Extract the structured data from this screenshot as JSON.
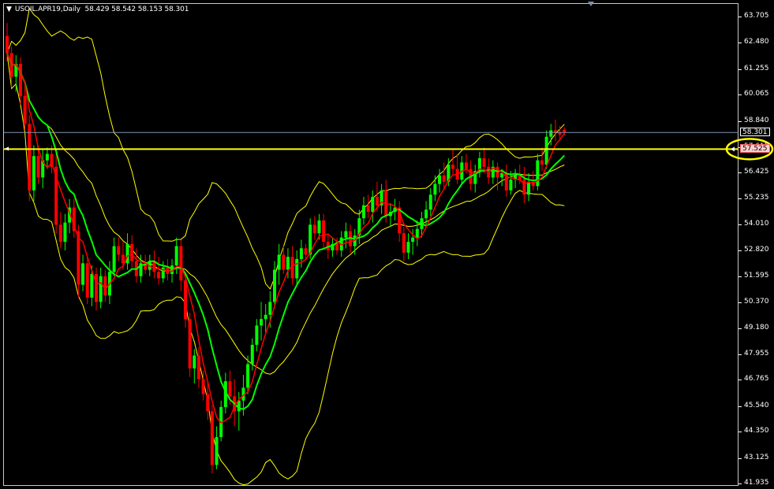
{
  "header": {
    "symbol_tf": "USOIL.APR19,Daily",
    "ohlc": "58.429 58.542 58.153 58.301"
  },
  "price_axis": {
    "labels": [
      "63.705",
      "62.480",
      "61.255",
      "60.065",
      "58.840",
      "57.615",
      "56.425",
      "55.235",
      "54.010",
      "52.820",
      "51.595",
      "50.370",
      "49.180",
      "47.955",
      "46.765",
      "45.540",
      "44.350",
      "43.125",
      "41.935"
    ],
    "range": [
      41.935,
      63.705
    ]
  },
  "markers": {
    "bid_line": {
      "price": 58.301,
      "label": "58.301",
      "color": "#7f96b4"
    },
    "horizontal_line": {
      "price": 57.525,
      "label": "57.525",
      "color": "#ffff00"
    }
  },
  "colors": {
    "bull": "#00ff00",
    "bear": "#ff0000",
    "ma_fast": "#ff0000",
    "ma_slow": "#00ff00",
    "bands": "#ffff00",
    "background": "#000000",
    "highlight_ellipse": "#ffff00"
  },
  "icons": {
    "dropdown": "triangle-down-icon",
    "shift_marker": "triangle-down-icon"
  },
  "chart_data": {
    "type": "candlestick",
    "ylim": [
      41.935,
      63.705
    ],
    "candles": [
      [
        62.8,
        63.4,
        61.6,
        62.0
      ],
      [
        62.0,
        62.3,
        60.4,
        60.9
      ],
      [
        60.9,
        61.9,
        60.2,
        61.5
      ],
      [
        61.5,
        61.8,
        59.6,
        60.0
      ],
      [
        60.0,
        60.6,
        58.4,
        58.7
      ],
      [
        58.7,
        59.1,
        55.1,
        55.6
      ],
      [
        55.6,
        57.7,
        55.1,
        57.2
      ],
      [
        57.2,
        57.7,
        55.9,
        56.2
      ],
      [
        56.2,
        57.5,
        55.7,
        57.0
      ],
      [
        57.0,
        57.6,
        56.6,
        57.3
      ],
      [
        57.3,
        57.7,
        56.4,
        56.7
      ],
      [
        56.7,
        57.4,
        53.6,
        54.0
      ],
      [
        54.0,
        54.6,
        52.9,
        53.2
      ],
      [
        53.2,
        54.5,
        52.8,
        54.1
      ],
      [
        54.1,
        55.2,
        53.6,
        54.8
      ],
      [
        54.8,
        55.2,
        53.4,
        53.7
      ],
      [
        53.7,
        54.0,
        50.6,
        51.2
      ],
      [
        51.2,
        52.6,
        50.9,
        52.2
      ],
      [
        52.2,
        52.5,
        50.3,
        50.6
      ],
      [
        50.6,
        52.1,
        50.2,
        51.7
      ],
      [
        51.7,
        52.0,
        50.0,
        50.4
      ],
      [
        50.4,
        52.0,
        50.1,
        51.6
      ],
      [
        51.6,
        51.9,
        50.4,
        50.7
      ],
      [
        50.7,
        52.3,
        50.3,
        51.8
      ],
      [
        51.8,
        53.4,
        51.6,
        53.0
      ],
      [
        53.0,
        53.4,
        52.3,
        52.6
      ],
      [
        52.6,
        53.2,
        51.9,
        52.2
      ],
      [
        52.2,
        53.6,
        51.9,
        53.1
      ],
      [
        53.1,
        53.5,
        52.0,
        52.3
      ],
      [
        52.3,
        52.9,
        51.3,
        51.6
      ],
      [
        51.6,
        52.6,
        51.3,
        52.2
      ],
      [
        52.2,
        52.6,
        51.7,
        51.9
      ],
      [
        51.9,
        52.6,
        51.6,
        52.3
      ],
      [
        52.3,
        52.8,
        51.5,
        51.8
      ],
      [
        51.8,
        52.5,
        51.2,
        51.5
      ],
      [
        51.5,
        52.3,
        51.3,
        52.0
      ],
      [
        52.0,
        52.4,
        51.4,
        51.7
      ],
      [
        51.7,
        52.4,
        51.3,
        52.1
      ],
      [
        52.1,
        53.4,
        51.7,
        53.0
      ],
      [
        53.0,
        53.3,
        50.9,
        51.4
      ],
      [
        51.4,
        51.8,
        49.2,
        49.6
      ],
      [
        49.6,
        49.9,
        46.9,
        47.3
      ],
      [
        47.3,
        48.2,
        46.6,
        47.9
      ],
      [
        47.9,
        48.3,
        46.4,
        46.8
      ],
      [
        46.8,
        47.2,
        45.8,
        46.1
      ],
      [
        46.1,
        46.7,
        44.9,
        45.3
      ],
      [
        45.3,
        45.6,
        42.4,
        42.8
      ],
      [
        42.8,
        44.6,
        42.6,
        44.1
      ],
      [
        44.1,
        45.8,
        43.9,
        45.5
      ],
      [
        45.5,
        47.1,
        45.2,
        46.7
      ],
      [
        46.7,
        47.2,
        45.6,
        46.0
      ],
      [
        46.0,
        46.8,
        44.6,
        45.3
      ],
      [
        45.3,
        46.2,
        44.4,
        45.8
      ],
      [
        45.8,
        47.0,
        45.1,
        46.4
      ],
      [
        46.4,
        47.9,
        46.1,
        47.5
      ],
      [
        47.5,
        48.7,
        47.2,
        48.4
      ],
      [
        48.4,
        49.6,
        48.1,
        49.3
      ],
      [
        49.3,
        50.4,
        48.6,
        49.6
      ],
      [
        49.6,
        50.3,
        49.0,
        49.8
      ],
      [
        49.8,
        50.9,
        49.2,
        50.4
      ],
      [
        50.4,
        52.3,
        50.1,
        51.9
      ],
      [
        51.9,
        53.1,
        51.2,
        52.6
      ],
      [
        52.6,
        53.0,
        51.7,
        51.9
      ],
      [
        51.9,
        52.9,
        51.5,
        52.5
      ],
      [
        52.5,
        53.0,
        51.2,
        51.5
      ],
      [
        51.5,
        52.8,
        51.2,
        52.4
      ],
      [
        52.4,
        53.3,
        52.0,
        52.9
      ],
      [
        52.9,
        53.1,
        52.4,
        52.6
      ],
      [
        52.6,
        54.3,
        52.4,
        54.0
      ],
      [
        54.0,
        54.4,
        53.3,
        53.6
      ],
      [
        53.6,
        54.5,
        53.3,
        54.2
      ],
      [
        54.2,
        54.5,
        52.9,
        53.2
      ],
      [
        53.2,
        53.6,
        52.4,
        52.8
      ],
      [
        52.8,
        53.4,
        52.5,
        53.1
      ],
      [
        53.1,
        53.4,
        52.6,
        52.8
      ],
      [
        52.8,
        53.7,
        52.5,
        53.4
      ],
      [
        53.4,
        54.1,
        52.9,
        53.7
      ],
      [
        53.7,
        54.0,
        52.7,
        53.0
      ],
      [
        53.0,
        53.8,
        52.6,
        53.5
      ],
      [
        53.5,
        54.7,
        53.1,
        54.3
      ],
      [
        54.3,
        55.3,
        54.0,
        54.9
      ],
      [
        54.9,
        55.4,
        54.3,
        54.6
      ],
      [
        54.6,
        55.6,
        54.1,
        55.3
      ],
      [
        55.3,
        56.0,
        54.6,
        54.9
      ],
      [
        54.9,
        55.9,
        54.5,
        55.6
      ],
      [
        55.6,
        56.1,
        54.1,
        54.4
      ],
      [
        54.4,
        55.0,
        53.9,
        54.6
      ],
      [
        54.6,
        55.2,
        54.2,
        54.8
      ],
      [
        54.8,
        55.1,
        53.2,
        53.6
      ],
      [
        53.6,
        53.9,
        52.3,
        52.7
      ],
      [
        52.7,
        53.6,
        52.4,
        53.2
      ],
      [
        53.2,
        53.8,
        52.6,
        53.4
      ],
      [
        53.4,
        54.2,
        53.0,
        53.8
      ],
      [
        53.8,
        54.6,
        53.4,
        54.3
      ],
      [
        54.3,
        55.1,
        54.0,
        54.7
      ],
      [
        54.7,
        55.7,
        54.4,
        55.4
      ],
      [
        55.4,
        56.3,
        55.1,
        55.9
      ],
      [
        55.9,
        56.6,
        55.5,
        56.3
      ],
      [
        56.3,
        56.9,
        55.7,
        56.0
      ],
      [
        56.0,
        57.1,
        55.8,
        56.8
      ],
      [
        56.8,
        57.5,
        56.3,
        56.6
      ],
      [
        56.6,
        57.3,
        55.9,
        56.1
      ],
      [
        56.1,
        57.2,
        55.9,
        56.9
      ],
      [
        56.9,
        57.3,
        56.4,
        56.6
      ],
      [
        56.6,
        57.0,
        55.6,
        55.9
      ],
      [
        55.9,
        56.8,
        55.5,
        56.5
      ],
      [
        56.5,
        57.4,
        56.2,
        57.1
      ],
      [
        57.1,
        57.6,
        56.4,
        56.7
      ],
      [
        56.7,
        57.1,
        55.9,
        56.2
      ],
      [
        56.2,
        57.0,
        55.9,
        56.7
      ],
      [
        56.7,
        56.9,
        55.6,
        56.2
      ],
      [
        56.2,
        56.6,
        55.8,
        56.4
      ],
      [
        56.4,
        56.8,
        55.3,
        55.6
      ],
      [
        55.6,
        56.5,
        55.4,
        56.1
      ],
      [
        56.1,
        56.6,
        55.7,
        56.3
      ],
      [
        56.3,
        56.8,
        55.9,
        56.1
      ],
      [
        56.1,
        56.7,
        55.0,
        55.4
      ],
      [
        55.4,
        56.4,
        55.1,
        56.0
      ],
      [
        56.0,
        56.5,
        55.6,
        55.8
      ],
      [
        55.8,
        57.3,
        55.6,
        57.0
      ],
      [
        57.0,
        57.6,
        56.5,
        56.8
      ],
      [
        56.8,
        58.4,
        56.6,
        58.1
      ],
      [
        58.1,
        58.7,
        57.7,
        58.4
      ],
      [
        58.4,
        58.9,
        57.9,
        58.3
      ],
      [
        58.3,
        58.6,
        58.0,
        58.2
      ],
      [
        58.429,
        58.542,
        58.153,
        58.301
      ]
    ]
  }
}
